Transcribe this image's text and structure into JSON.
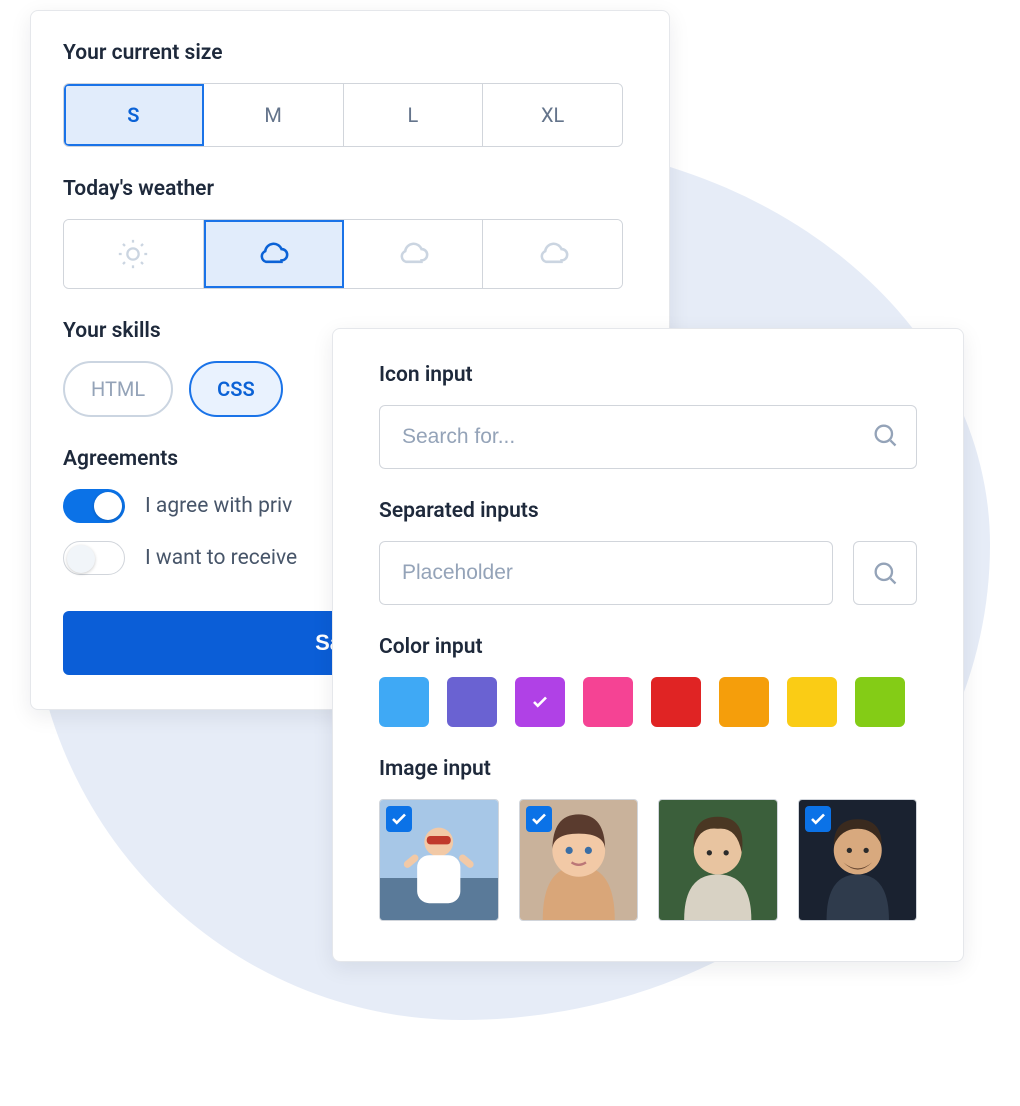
{
  "card_a": {
    "size": {
      "label": "Your current size",
      "options": [
        "S",
        "M",
        "L",
        "XL"
      ],
      "selected": "S"
    },
    "weather": {
      "label": "Today's weather",
      "options": [
        "sun",
        "cloud",
        "cloud-alt1",
        "cloud-alt2"
      ],
      "selected": "cloud"
    },
    "skills": {
      "label": "Your skills",
      "options": [
        "HTML",
        "CSS"
      ],
      "selected": [
        "CSS"
      ]
    },
    "agreements": {
      "label": "Agreements",
      "items": [
        {
          "text": "I agree with priv",
          "on": true
        },
        {
          "text": "I want to receive",
          "on": false
        }
      ]
    },
    "save_label": "Save c"
  },
  "card_b": {
    "icon_input": {
      "label": "Icon input",
      "placeholder": "Search for..."
    },
    "separated": {
      "label": "Separated inputs",
      "placeholder": "Placeholder"
    },
    "color_input": {
      "label": "Color input",
      "colors": [
        "#3fa9f5",
        "#6a62d2",
        "#b041e6",
        "#f54394",
        "#e02424",
        "#f59e0b",
        "#facc15",
        "#84cc16"
      ],
      "selected_index": 2
    },
    "image_input": {
      "label": "Image input",
      "selected": [
        true,
        true,
        false,
        true
      ]
    }
  }
}
